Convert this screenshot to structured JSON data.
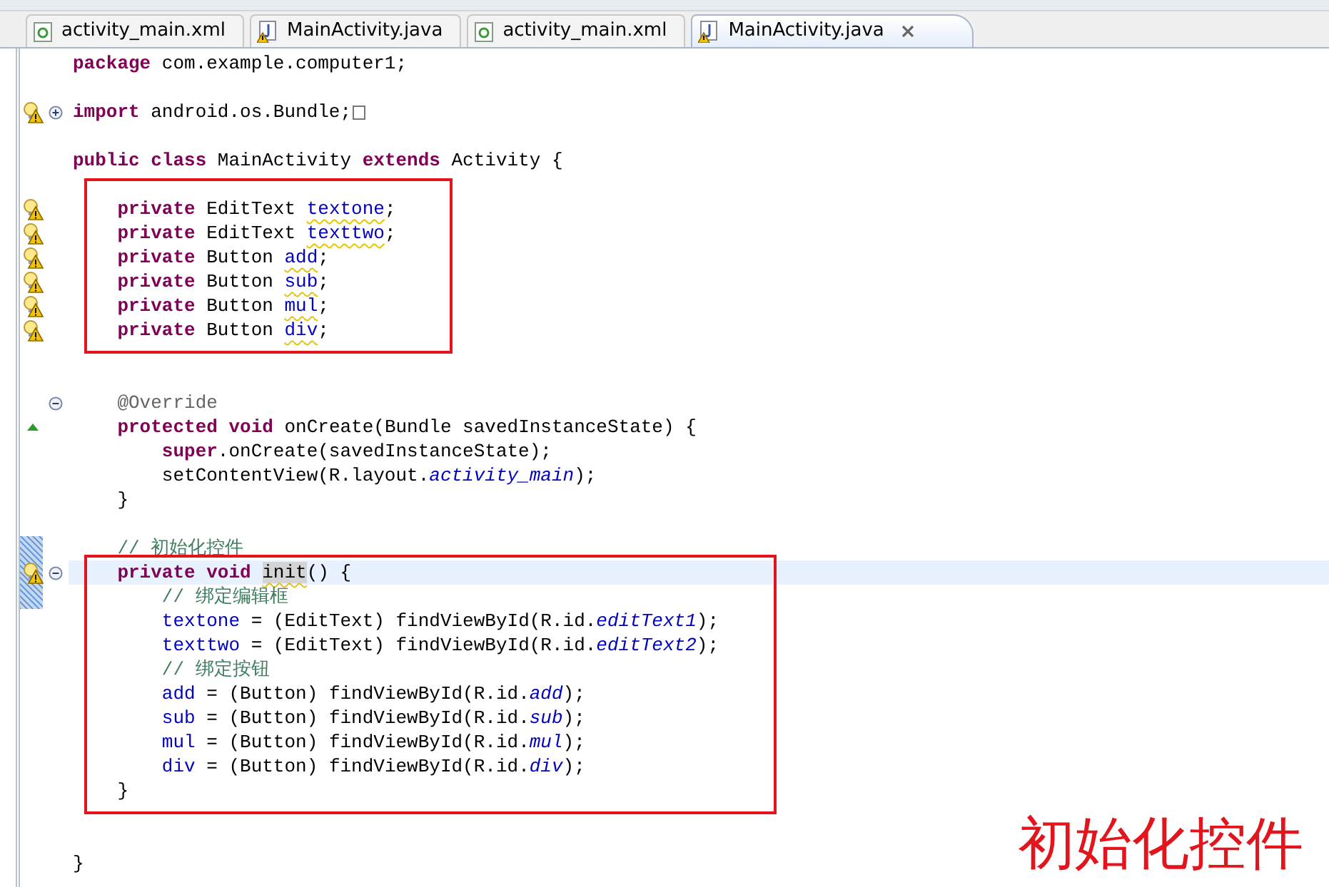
{
  "tabs": [
    {
      "label": "activity_main.xml",
      "kind": "xml",
      "warning": false,
      "selected": false,
      "closable": false
    },
    {
      "label": "MainActivity.java",
      "kind": "java",
      "warning": true,
      "selected": false,
      "closable": false
    },
    {
      "label": "activity_main.xml",
      "kind": "xml",
      "warning": false,
      "selected": false,
      "closable": false
    },
    {
      "label": "MainActivity.java",
      "kind": "java",
      "warning": true,
      "selected": true,
      "closable": true
    }
  ],
  "sections": [
    {
      "boxed": false,
      "lines": [
        {
          "kind": "code",
          "tokens": [
            {
              "kind": "kw",
              "text": "package"
            },
            {
              "kind": "plain",
              "text": " com.example.computer1;"
            }
          ]
        },
        {
          "kind": "blank"
        },
        {
          "kind": "code",
          "warning": true,
          "foldable": true,
          "folded": true,
          "tokens": [
            {
              "kind": "kw",
              "text": "import"
            },
            {
              "kind": "plain",
              "text": " android.os.Bundle;"
            }
          ]
        },
        {
          "kind": "blank"
        },
        {
          "kind": "code",
          "tokens": [
            {
              "kind": "kw",
              "text": "public class"
            },
            {
              "kind": "plain",
              "text": " MainActivity "
            },
            {
              "kind": "kw",
              "text": "extends"
            },
            {
              "kind": "plain",
              "text": " Activity {"
            }
          ]
        }
      ]
    },
    {
      "boxed": true,
      "lines": [
        {
          "kind": "blank"
        },
        {
          "kind": "code",
          "warning": true,
          "tokens": [
            {
              "kind": "kw",
              "text": "    private"
            },
            {
              "kind": "plain",
              "text": " EditText "
            },
            {
              "kind": "field",
              "squiggle": true,
              "text": "textone"
            },
            {
              "kind": "plain",
              "text": ";"
            }
          ]
        },
        {
          "kind": "code",
          "warning": true,
          "tokens": [
            {
              "kind": "kw",
              "text": "    private"
            },
            {
              "kind": "plain",
              "text": " EditText "
            },
            {
              "kind": "field",
              "squiggle": true,
              "text": "texttwo"
            },
            {
              "kind": "plain",
              "text": ";"
            }
          ]
        },
        {
          "kind": "code",
          "warning": true,
          "tokens": [
            {
              "kind": "kw",
              "text": "    private"
            },
            {
              "kind": "plain",
              "text": " Button "
            },
            {
              "kind": "field",
              "squiggle": true,
              "text": "add"
            },
            {
              "kind": "plain",
              "text": ";"
            }
          ]
        },
        {
          "kind": "code",
          "warning": true,
          "tokens": [
            {
              "kind": "kw",
              "text": "    private"
            },
            {
              "kind": "plain",
              "text": " Button "
            },
            {
              "kind": "field",
              "squiggle": true,
              "text": "sub"
            },
            {
              "kind": "plain",
              "text": ";"
            }
          ]
        },
        {
          "kind": "code",
          "warning": true,
          "tokens": [
            {
              "kind": "kw",
              "text": "    private"
            },
            {
              "kind": "plain",
              "text": " Button "
            },
            {
              "kind": "field",
              "squiggle": true,
              "text": "mul"
            },
            {
              "kind": "plain",
              "text": ";"
            }
          ]
        },
        {
          "kind": "code",
          "warning": true,
          "tokens": [
            {
              "kind": "kw",
              "text": "    private"
            },
            {
              "kind": "plain",
              "text": " Button "
            },
            {
              "kind": "field",
              "squiggle": true,
              "text": "div"
            },
            {
              "kind": "plain",
              "text": ";"
            }
          ]
        }
      ]
    },
    {
      "boxed": false,
      "lines": [
        {
          "kind": "blank"
        },
        {
          "kind": "blank"
        },
        {
          "kind": "code",
          "foldable": true,
          "folded": false,
          "tokens": [
            {
              "kind": "annotation",
              "text": "    @Override"
            }
          ]
        },
        {
          "kind": "code",
          "override": true,
          "tokens": [
            {
              "kind": "kw",
              "text": "    protected void"
            },
            {
              "kind": "plain",
              "text": " onCreate(Bundle savedInstanceState) {"
            }
          ]
        },
        {
          "kind": "code",
          "tokens": [
            {
              "kind": "kw",
              "text": "        super"
            },
            {
              "kind": "plain",
              "text": ".onCreate(savedInstanceState);"
            }
          ]
        },
        {
          "kind": "code",
          "tokens": [
            {
              "kind": "plain",
              "text": "        setContentView(R.layout."
            },
            {
              "kind": "static",
              "text": "activity_main"
            },
            {
              "kind": "plain",
              "text": ");"
            }
          ]
        },
        {
          "kind": "code",
          "tokens": [
            {
              "kind": "plain",
              "text": "    }"
            }
          ]
        },
        {
          "kind": "blank"
        },
        {
          "kind": "code",
          "range": true,
          "tokens": [
            {
              "kind": "comment",
              "text": "    // 初始化控件"
            }
          ]
        }
      ]
    },
    {
      "boxed": true,
      "lines": [
        {
          "kind": "code",
          "range": true,
          "current": true,
          "warning": true,
          "foldable": true,
          "folded": false,
          "tokens": [
            {
              "kind": "kw",
              "text": "    private void "
            },
            {
              "kind": "occurrence",
              "squiggle": true,
              "text": "init"
            },
            {
              "kind": "plain",
              "text": "() {"
            }
          ]
        },
        {
          "kind": "code",
          "range": true,
          "tokens": [
            {
              "kind": "comment",
              "text": "        // 绑定编辑框"
            }
          ]
        },
        {
          "kind": "code",
          "tokens": [
            {
              "kind": "field",
              "text": "        textone"
            },
            {
              "kind": "plain",
              "text": " = (EditText) findViewById(R.id."
            },
            {
              "kind": "static",
              "text": "editText1"
            },
            {
              "kind": "plain",
              "text": ");"
            }
          ]
        },
        {
          "kind": "code",
          "tokens": [
            {
              "kind": "field",
              "text": "        texttwo"
            },
            {
              "kind": "plain",
              "text": " = (EditText) findViewById(R.id."
            },
            {
              "kind": "static",
              "text": "editText2"
            },
            {
              "kind": "plain",
              "text": ");"
            }
          ]
        },
        {
          "kind": "code",
          "tokens": [
            {
              "kind": "comment",
              "text": "        // 绑定按钮"
            }
          ]
        },
        {
          "kind": "code",
          "tokens": [
            {
              "kind": "field",
              "text": "        add"
            },
            {
              "kind": "plain",
              "text": " = (Button) findViewById(R.id."
            },
            {
              "kind": "static",
              "text": "add"
            },
            {
              "kind": "plain",
              "text": ");"
            }
          ]
        },
        {
          "kind": "code",
          "tokens": [
            {
              "kind": "field",
              "text": "        sub"
            },
            {
              "kind": "plain",
              "text": " = (Button) findViewById(R.id."
            },
            {
              "kind": "static",
              "text": "sub"
            },
            {
              "kind": "plain",
              "text": ");"
            }
          ]
        },
        {
          "kind": "code",
          "tokens": [
            {
              "kind": "field",
              "text": "        mul"
            },
            {
              "kind": "plain",
              "text": " = (Button) findViewById(R.id."
            },
            {
              "kind": "static",
              "text": "mul"
            },
            {
              "kind": "plain",
              "text": ");"
            }
          ]
        },
        {
          "kind": "code",
          "tokens": [
            {
              "kind": "field",
              "text": "        div"
            },
            {
              "kind": "plain",
              "text": " = (Button) findViewById(R.id."
            },
            {
              "kind": "static",
              "text": "div"
            },
            {
              "kind": "plain",
              "text": ");"
            }
          ]
        },
        {
          "kind": "code",
          "tokens": [
            {
              "kind": "plain",
              "text": "    }"
            }
          ]
        }
      ]
    },
    {
      "boxed": false,
      "lines": [
        {
          "kind": "blank"
        },
        {
          "kind": "blank"
        },
        {
          "kind": "code",
          "tokens": [
            {
              "kind": "plain",
              "text": "}"
            }
          ]
        }
      ]
    }
  ],
  "caption": "初始化控件"
}
